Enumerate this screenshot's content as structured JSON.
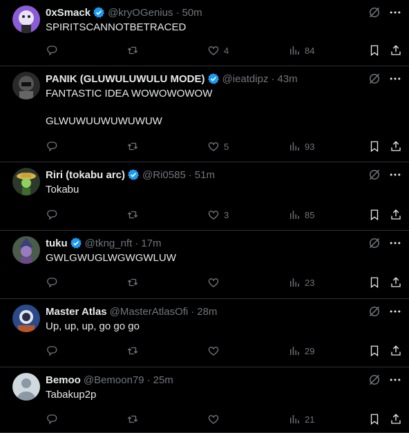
{
  "tweets": [
    {
      "name": "0xSmack",
      "verified": true,
      "handle": "@kryOGenius",
      "dot": "·",
      "time": "50m",
      "text": "SPIRITSCANNOTBETRACED",
      "likes": "4",
      "views": "84",
      "avatar_color": "#8a5cd6"
    },
    {
      "name": "PANIK (GLUWULUWULU MODE)",
      "verified": true,
      "handle": "@ieatdipz",
      "dot": "·",
      "time": "43m",
      "text": "FANTASTIC IDEA WOWOWOWOW\n\nGLWUWUUWUWUWUW",
      "likes": "5",
      "views": "93",
      "avatar_color": "#555555"
    },
    {
      "name": "Riri (tokabu arc)",
      "verified": true,
      "handle": "@Ri0585",
      "dot": "·",
      "time": "51m",
      "text": "Tokabu",
      "likes": "3",
      "views": "85",
      "avatar_color": "#2b3a2b"
    },
    {
      "name": "tuku",
      "verified": true,
      "handle": "@tkng_nft",
      "dot": "·",
      "time": "17m",
      "text": "GWLGWUGLWGWGWLUW",
      "likes": "",
      "views": "23",
      "avatar_color": "#4a5c4a"
    },
    {
      "name": "Master Atlas",
      "verified": false,
      "handle": "@MasterAtlasOfi",
      "dot": "·",
      "time": "28m",
      "text": "Up, up, up, go go go",
      "likes": "",
      "views": "29",
      "avatar_color": "#2a4a8a"
    },
    {
      "name": "Bemoo",
      "verified": false,
      "handle": "@Bemoon79",
      "dot": "·",
      "time": "25m",
      "text": "Tabakup2p",
      "likes": "",
      "views": "21",
      "avatar_color": "#cfd9de"
    }
  ],
  "colors": {
    "background": "#000000",
    "text": "#e7e9ea",
    "muted": "#71767b",
    "verified": "#1d9bf0",
    "divider": "#2f3336"
  },
  "icons": [
    "reply-icon",
    "retweet-icon",
    "like-icon",
    "views-icon",
    "bookmark-icon",
    "share-icon",
    "grok-icon",
    "more-icon",
    "verified-badge-icon"
  ]
}
